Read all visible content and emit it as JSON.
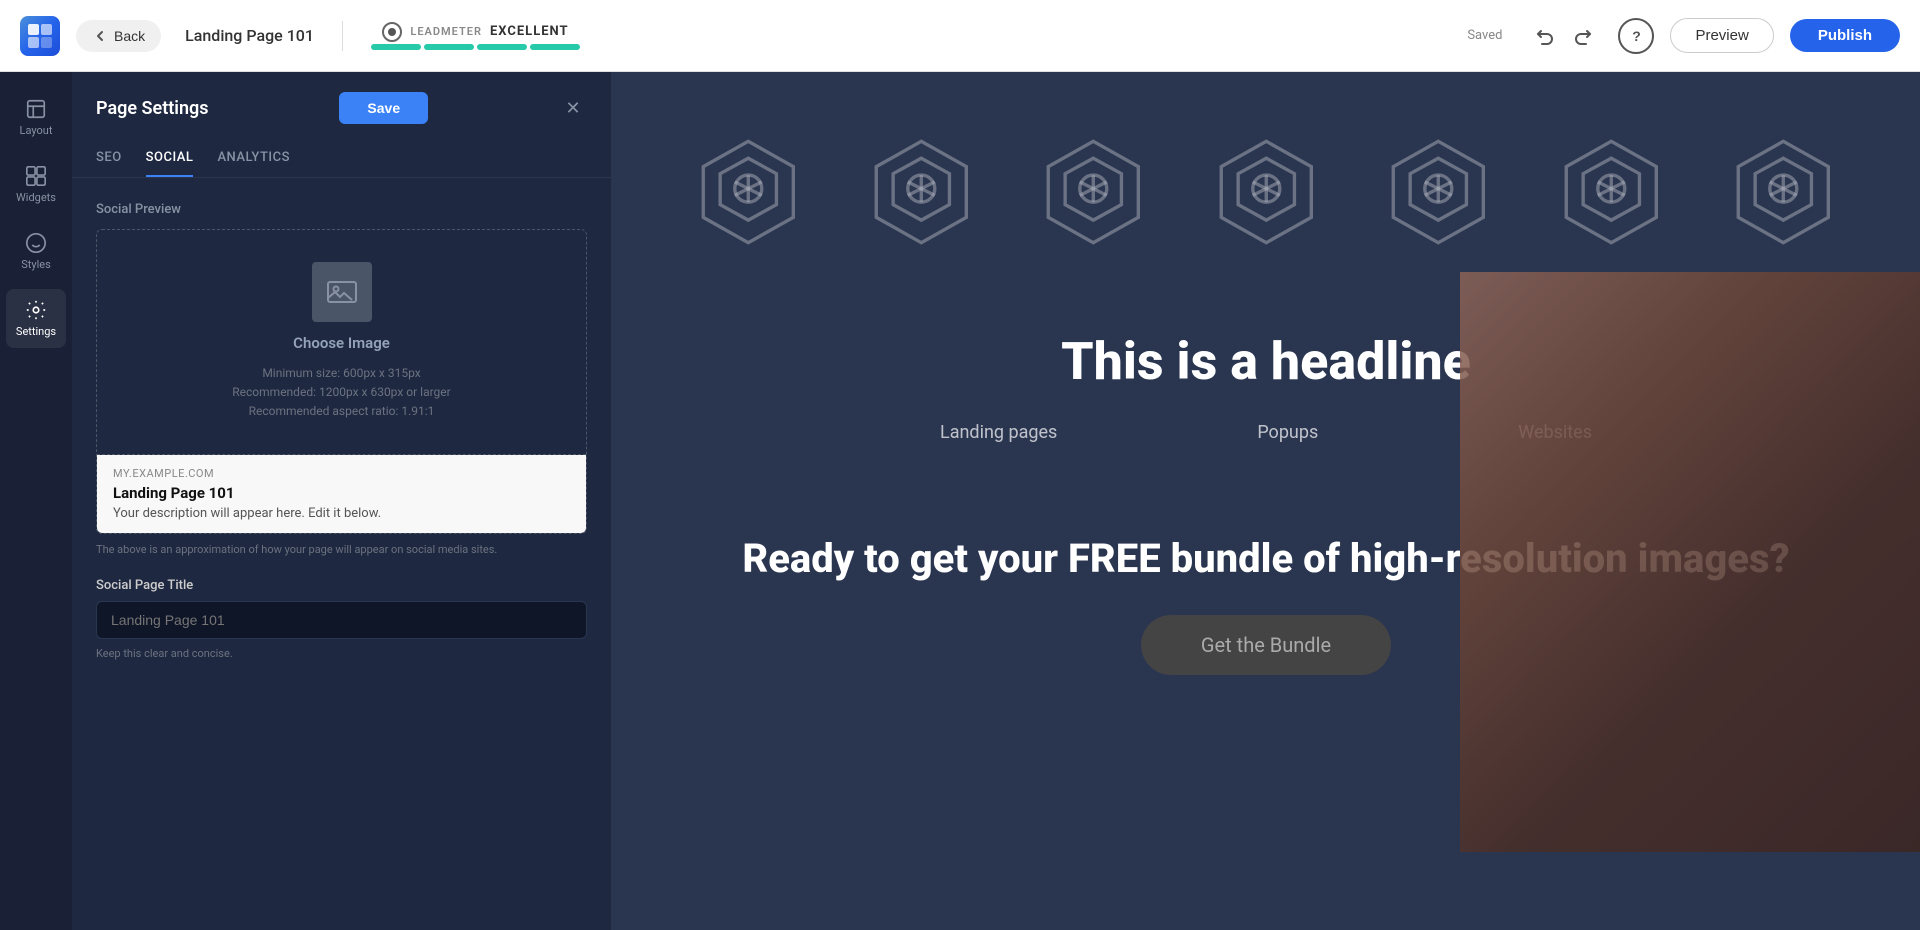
{
  "topbar": {
    "page_title": "Landing Page 101",
    "back_label": "Back",
    "leadmeter_label": "LEADMETER",
    "leadmeter_value": "EXCELLENT",
    "saved_label": "Saved",
    "preview_label": "Preview",
    "publish_label": "Publish"
  },
  "sidebar": {
    "items": [
      {
        "label": "Layout",
        "icon": "layout-icon"
      },
      {
        "label": "Widgets",
        "icon": "widgets-icon"
      },
      {
        "label": "Styles",
        "icon": "styles-icon"
      },
      {
        "label": "Settings",
        "icon": "settings-icon"
      }
    ]
  },
  "settings_panel": {
    "title": "Page Settings",
    "save_label": "Save",
    "tabs": [
      {
        "label": "SEO"
      },
      {
        "label": "SOCIAL",
        "active": true
      },
      {
        "label": "ANALYTICS"
      }
    ],
    "social_preview": {
      "section_label": "Social Preview",
      "choose_image_label": "Choose Image",
      "hint_line1": "Minimum size: 600px x 315px",
      "hint_line2": "Recommended: 1200px x 630px or larger",
      "hint_line3": "Recommended aspect ratio: 1.91:1",
      "domain": "MY.EXAMPLE.COM",
      "preview_title": "Landing Page 101",
      "preview_description": "Your description will appear here. Edit it below.",
      "preview_note": "The above is an approximation of how your page will appear on social media sites."
    },
    "social_page_title": {
      "label": "Social Page Title",
      "placeholder": "Landing Page 101",
      "hint": "Keep this clear and concise."
    }
  },
  "canvas": {
    "headline": "This is a headline",
    "sub_links": [
      "Landing pages",
      "Popups",
      "Websites"
    ],
    "cta_headline": "Ready to get your FREE bundle of high-resolution images?",
    "cta_button": "Get the Bundle"
  }
}
